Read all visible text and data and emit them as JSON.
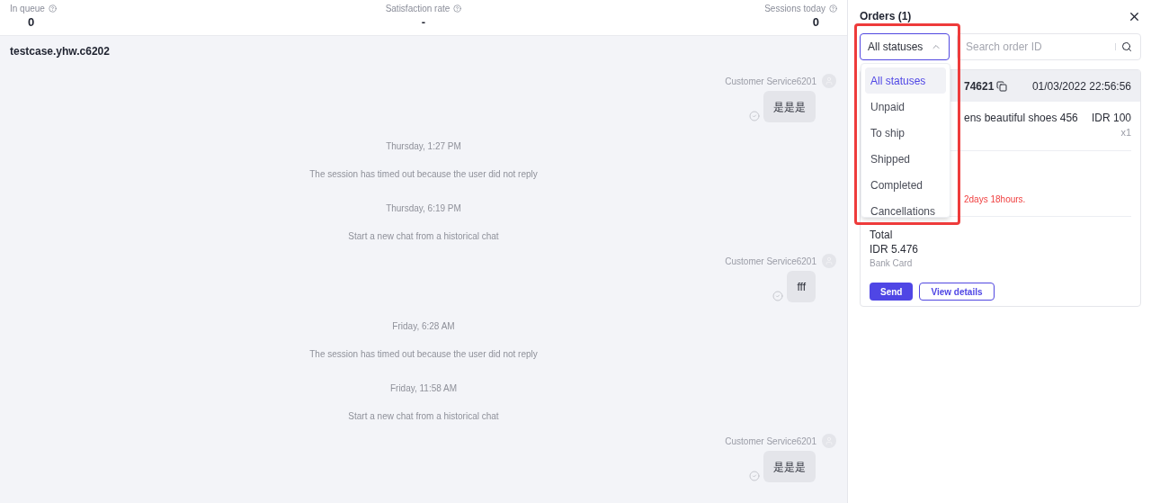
{
  "stats": [
    {
      "label": "In queue",
      "value": "0"
    },
    {
      "label": "Satisfaction rate",
      "value": "-"
    },
    {
      "label": "Sessions today",
      "value": "0"
    }
  ],
  "chat": {
    "title": "testcase.yhw.c6202",
    "items": [
      {
        "kind": "agent",
        "sender": "Customer Service6201",
        "text": "是是是"
      },
      {
        "kind": "time",
        "text": "Thursday, 1:27 PM"
      },
      {
        "kind": "notice",
        "text": "The session has timed out because the user did not reply"
      },
      {
        "kind": "time",
        "text": "Thursday, 6:19 PM"
      },
      {
        "kind": "notice",
        "text": "Start a new chat from a historical chat"
      },
      {
        "kind": "agent",
        "sender": "Customer Service6201",
        "text": "fff"
      },
      {
        "kind": "time",
        "text": "Friday, 6:28 AM"
      },
      {
        "kind": "notice",
        "text": "The session has timed out because the user did not reply"
      },
      {
        "kind": "time",
        "text": "Friday, 11:58 AM"
      },
      {
        "kind": "notice",
        "text": "Start a new chat from a historical chat"
      },
      {
        "kind": "agent",
        "sender": "Customer Service6201",
        "text": "是是是"
      }
    ]
  },
  "orders": {
    "title": "Orders (1)",
    "filter": {
      "value": "All statuses",
      "expanded": true,
      "options": [
        {
          "label": "All statuses",
          "selected": true
        },
        {
          "label": "Unpaid",
          "selected": false
        },
        {
          "label": "To ship",
          "selected": false
        },
        {
          "label": "Shipped",
          "selected": false
        },
        {
          "label": "Completed",
          "selected": false
        },
        {
          "label": "Cancellations",
          "selected": false
        }
      ]
    },
    "search": {
      "placeholder": "Search order ID"
    },
    "order": {
      "id": "74621",
      "date": "01/03/2022 22:56:56",
      "product": "ens beautiful shoes 456",
      "price": "IDR 100",
      "quantity": "x1",
      "notice": "2days 18hours.",
      "total_label": "Total",
      "total": "IDR 5.476",
      "payment": "Bank Card",
      "buttons": [
        {
          "label": "Send",
          "kind": "primary"
        },
        {
          "label": "View details",
          "kind": "outline"
        }
      ]
    }
  }
}
